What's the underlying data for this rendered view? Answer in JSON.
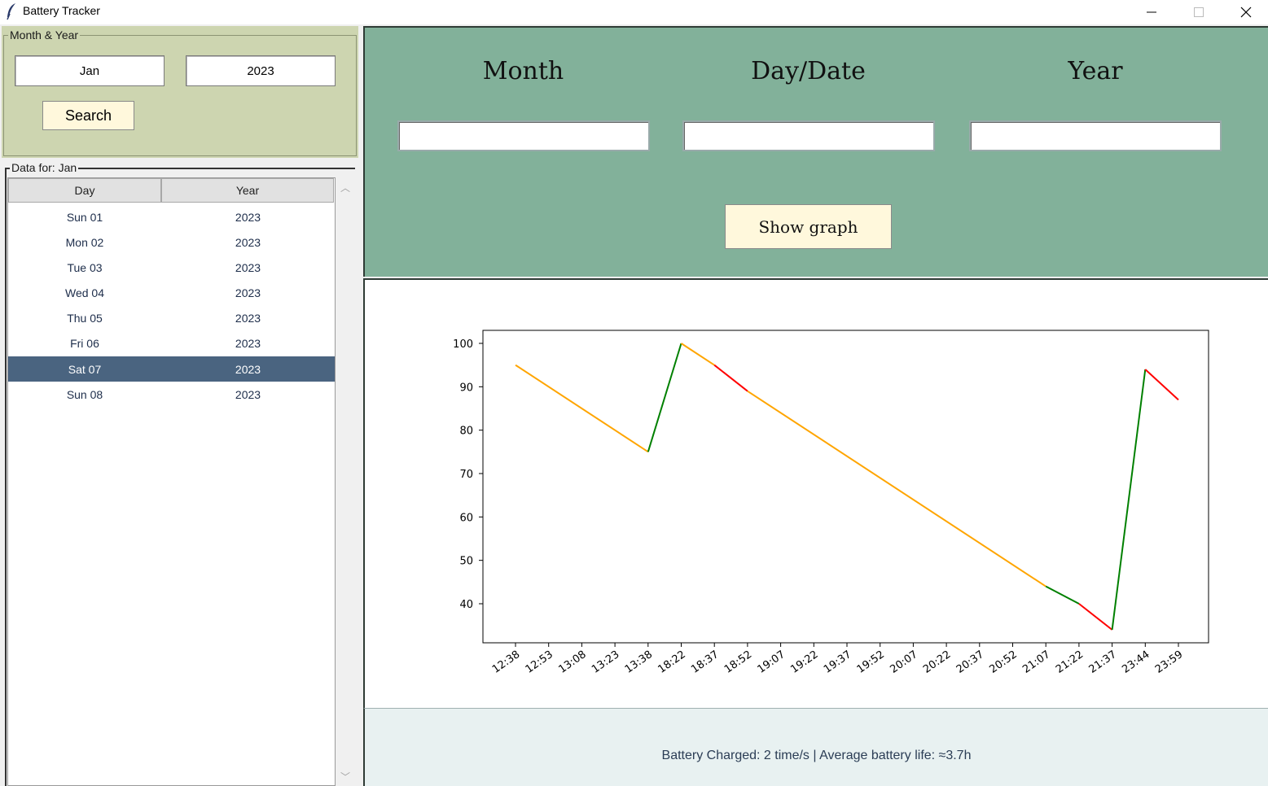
{
  "window": {
    "title": "Battery Tracker"
  },
  "left": {
    "month_year_legend": "Month & Year",
    "month_value": "Jan",
    "year_value": "2023",
    "search_label": "Search",
    "data_legend": "Data for: Jan",
    "columns": [
      "Day",
      "Year"
    ],
    "rows": [
      {
        "day": "Sun 01",
        "year": "2023"
      },
      {
        "day": "Mon 02",
        "year": "2023"
      },
      {
        "day": "Tue 03",
        "year": "2023"
      },
      {
        "day": "Wed 04",
        "year": "2023"
      },
      {
        "day": "Thu 05",
        "year": "2023"
      },
      {
        "day": "Fri 06",
        "year": "2023"
      },
      {
        "day": "Sat 07",
        "year": "2023",
        "selected": true
      },
      {
        "day": "Sun 08",
        "year": "2023"
      }
    ]
  },
  "form": {
    "month_label": "Month",
    "day_label": "Day/Date",
    "year_label": "Year",
    "month_value": "",
    "day_value": "",
    "year_value": "",
    "show_graph_label": "Show graph"
  },
  "chart_data": {
    "type": "line",
    "title": "",
    "xlabel": "",
    "ylabel": "",
    "categories": [
      "12:38",
      "12:53",
      "13:08",
      "13:23",
      "13:38",
      "18:22",
      "18:37",
      "18:52",
      "19:07",
      "19:22",
      "19:37",
      "19:52",
      "20:07",
      "20:22",
      "20:37",
      "20:52",
      "21:07",
      "21:22",
      "21:37",
      "23:44",
      "23:59"
    ],
    "points": [
      {
        "x": "12:38",
        "y": 95
      },
      {
        "x": "13:38",
        "y": 75
      },
      {
        "x": "18:22",
        "y": 100
      },
      {
        "x": "18:37",
        "y": 95
      },
      {
        "x": "18:52",
        "y": 89
      },
      {
        "x": "21:07",
        "y": 44
      },
      {
        "x": "21:22",
        "y": 40
      },
      {
        "x": "21:37",
        "y": 34
      },
      {
        "x": "23:44",
        "y": 94
      },
      {
        "x": "23:59",
        "y": 87
      }
    ],
    "segment_colors": [
      "#ffa500",
      "#008000",
      "#ffa500",
      "#ff0000",
      "#ffa500",
      "#008000",
      "#ff0000",
      "#008000",
      "#ff0000"
    ],
    "yticks": [
      40,
      50,
      60,
      70,
      80,
      90,
      100
    ],
    "ylim": [
      31,
      103
    ],
    "grid": false
  },
  "status": {
    "text": "Battery Charged: 2 time/s | Average battery life: ≈3.7h"
  },
  "colors": {
    "left_frame_bg": "#cdd5b0",
    "form_bg": "#82b19a",
    "button_bg": "#fff8dc",
    "selected_row": "#4a6480",
    "status_bg": "#e8f1f1"
  }
}
